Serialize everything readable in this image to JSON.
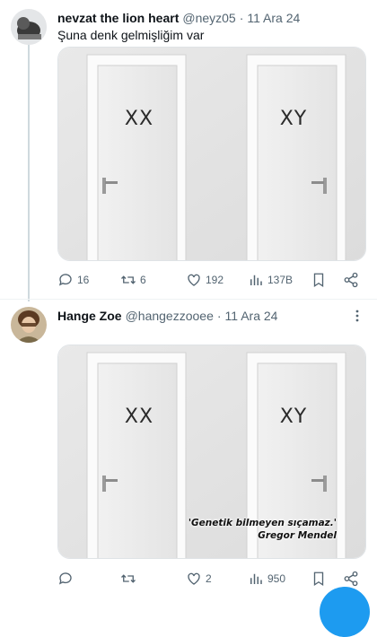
{
  "tweets": [
    {
      "author_name": "nevzat the lion heart",
      "handle": "@neyz05",
      "separator": "·",
      "date": "11 Ara 24",
      "text": "Şuna denk gelmişliğim var",
      "doors": {
        "left_label": "XX",
        "right_label": "XY"
      },
      "actions": {
        "replies": "16",
        "reposts": "6",
        "likes": "192",
        "views": "137B"
      }
    },
    {
      "author_name": "Hange Zoe",
      "handle": "@hangezzooee",
      "separator": "·",
      "date": "11 Ara 24",
      "doors": {
        "left_label": "XX",
        "right_label": "XY"
      },
      "caption_quote": "'Genetik bilmeyen sıçamaz.'",
      "caption_author": "Gregor Mendel",
      "actions": {
        "replies": "",
        "reposts": "",
        "likes": "2",
        "views": "950"
      }
    }
  ],
  "icons": [
    "reply-icon",
    "repost-icon",
    "like-icon",
    "views-icon",
    "bookmark-icon",
    "share-icon",
    "more-icon"
  ],
  "colors": {
    "icon_gray": "#536471",
    "thread_line": "#cfd9de",
    "accent": "#1d9bf0"
  }
}
